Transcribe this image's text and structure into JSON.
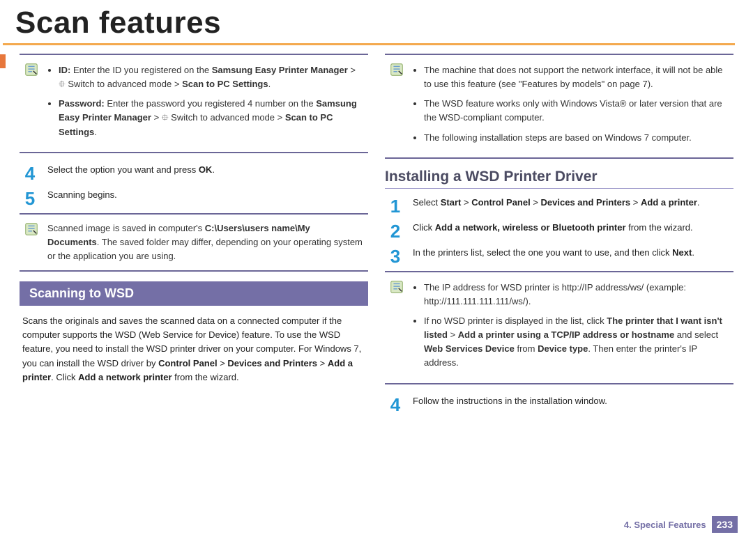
{
  "page": {
    "title": "Scan features",
    "footer_label": "4.  Special Features",
    "page_number": "233"
  },
  "left": {
    "note1_bullet1_html": "<b>ID:</b> Enter the ID you registered on the <b>Samsung Easy Printer Manager</b> > <span class='ruled'>⯐</span> Switch to advanced mode > <b>Scan to PC Settings</b>.",
    "note1_bullet2_html": "<b>Password:</b> Enter the password you registered 4 number on the <b>Samsung Easy Printer Manager</b> > <span class='ruled'>⯐</span> Switch to advanced mode > <b>Scan to PC Settings</b>.",
    "step4": "Select the option you want and press <b>OK</b>.",
    "step5": "Scanning begins.",
    "note2_html": "Scanned image is saved in computer's <b>C:\\Users\\users name\\My Documents</b>. The saved folder may differ, depending on your operating system or the application you are using.",
    "section_title": "Scanning to WSD",
    "wsd_para_html": "Scans the originals and saves the scanned data on a connected computer if the computer supports the WSD (Web Service for Device) feature. To use the WSD feature, you need to install the WSD printer driver on your computer. For Windows 7, you can install the WSD driver by <b>Control Panel</b> > <b>Devices and Printers</b> > <b>Add a printer</b>. Click <b>Add a network printer</b> from the wizard."
  },
  "right": {
    "note3_b1": "The machine that does not support the network interface, it will not be able to use this feature (see \"Features by models\" on page 7).",
    "note3_b2": "The WSD feature works only with Windows Vista® or later version that are the WSD-compliant computer.",
    "note3_b3": "The following installation steps are based on Windows 7 computer.",
    "subheading": "Installing a WSD Printer Driver",
    "step1_html": "Select <b>Start</b> > <b>Control Panel</b> > <b>Devices and Printers</b> > <b>Add a printer</b>.",
    "step2_html": "Click <b>Add a network, wireless or Bluetooth printer</b> from the wizard.",
    "step3_html": "In the printers list, select the one you want to use, and then click <b>Next</b>.",
    "note4_b1_html": "The IP address for WSD printer is http://IP address/ws/ (example: http://111.111.111.111/ws/).",
    "note4_b2_html": "If no WSD printer is displayed in the list, click <b>The printer that I want isn't listed</b> > <b>Add a printer using a TCP/IP address or hostname</b> and select <b>Web Services Device</b> from <b>Device type</b>. Then enter the printer's IP address.",
    "step4": "Follow the instructions in the installation window."
  }
}
